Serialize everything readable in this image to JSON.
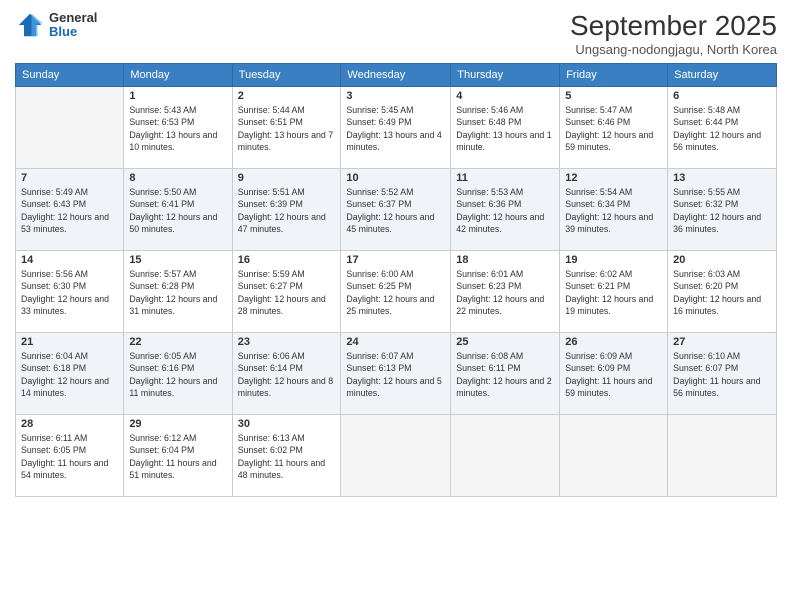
{
  "header": {
    "logo_general": "General",
    "logo_blue": "Blue",
    "month_title": "September 2025",
    "location": "Ungsang-nodongjagu, North Korea"
  },
  "days_of_week": [
    "Sunday",
    "Monday",
    "Tuesday",
    "Wednesday",
    "Thursday",
    "Friday",
    "Saturday"
  ],
  "weeks": [
    [
      {
        "day": "",
        "sunrise": "",
        "sunset": "",
        "daylight": ""
      },
      {
        "day": "1",
        "sunrise": "Sunrise: 5:43 AM",
        "sunset": "Sunset: 6:53 PM",
        "daylight": "Daylight: 13 hours and 10 minutes."
      },
      {
        "day": "2",
        "sunrise": "Sunrise: 5:44 AM",
        "sunset": "Sunset: 6:51 PM",
        "daylight": "Daylight: 13 hours and 7 minutes."
      },
      {
        "day": "3",
        "sunrise": "Sunrise: 5:45 AM",
        "sunset": "Sunset: 6:49 PM",
        "daylight": "Daylight: 13 hours and 4 minutes."
      },
      {
        "day": "4",
        "sunrise": "Sunrise: 5:46 AM",
        "sunset": "Sunset: 6:48 PM",
        "daylight": "Daylight: 13 hours and 1 minute."
      },
      {
        "day": "5",
        "sunrise": "Sunrise: 5:47 AM",
        "sunset": "Sunset: 6:46 PM",
        "daylight": "Daylight: 12 hours and 59 minutes."
      },
      {
        "day": "6",
        "sunrise": "Sunrise: 5:48 AM",
        "sunset": "Sunset: 6:44 PM",
        "daylight": "Daylight: 12 hours and 56 minutes."
      }
    ],
    [
      {
        "day": "7",
        "sunrise": "Sunrise: 5:49 AM",
        "sunset": "Sunset: 6:43 PM",
        "daylight": "Daylight: 12 hours and 53 minutes."
      },
      {
        "day": "8",
        "sunrise": "Sunrise: 5:50 AM",
        "sunset": "Sunset: 6:41 PM",
        "daylight": "Daylight: 12 hours and 50 minutes."
      },
      {
        "day": "9",
        "sunrise": "Sunrise: 5:51 AM",
        "sunset": "Sunset: 6:39 PM",
        "daylight": "Daylight: 12 hours and 47 minutes."
      },
      {
        "day": "10",
        "sunrise": "Sunrise: 5:52 AM",
        "sunset": "Sunset: 6:37 PM",
        "daylight": "Daylight: 12 hours and 45 minutes."
      },
      {
        "day": "11",
        "sunrise": "Sunrise: 5:53 AM",
        "sunset": "Sunset: 6:36 PM",
        "daylight": "Daylight: 12 hours and 42 minutes."
      },
      {
        "day": "12",
        "sunrise": "Sunrise: 5:54 AM",
        "sunset": "Sunset: 6:34 PM",
        "daylight": "Daylight: 12 hours and 39 minutes."
      },
      {
        "day": "13",
        "sunrise": "Sunrise: 5:55 AM",
        "sunset": "Sunset: 6:32 PM",
        "daylight": "Daylight: 12 hours and 36 minutes."
      }
    ],
    [
      {
        "day": "14",
        "sunrise": "Sunrise: 5:56 AM",
        "sunset": "Sunset: 6:30 PM",
        "daylight": "Daylight: 12 hours and 33 minutes."
      },
      {
        "day": "15",
        "sunrise": "Sunrise: 5:57 AM",
        "sunset": "Sunset: 6:28 PM",
        "daylight": "Daylight: 12 hours and 31 minutes."
      },
      {
        "day": "16",
        "sunrise": "Sunrise: 5:59 AM",
        "sunset": "Sunset: 6:27 PM",
        "daylight": "Daylight: 12 hours and 28 minutes."
      },
      {
        "day": "17",
        "sunrise": "Sunrise: 6:00 AM",
        "sunset": "Sunset: 6:25 PM",
        "daylight": "Daylight: 12 hours and 25 minutes."
      },
      {
        "day": "18",
        "sunrise": "Sunrise: 6:01 AM",
        "sunset": "Sunset: 6:23 PM",
        "daylight": "Daylight: 12 hours and 22 minutes."
      },
      {
        "day": "19",
        "sunrise": "Sunrise: 6:02 AM",
        "sunset": "Sunset: 6:21 PM",
        "daylight": "Daylight: 12 hours and 19 minutes."
      },
      {
        "day": "20",
        "sunrise": "Sunrise: 6:03 AM",
        "sunset": "Sunset: 6:20 PM",
        "daylight": "Daylight: 12 hours and 16 minutes."
      }
    ],
    [
      {
        "day": "21",
        "sunrise": "Sunrise: 6:04 AM",
        "sunset": "Sunset: 6:18 PM",
        "daylight": "Daylight: 12 hours and 14 minutes."
      },
      {
        "day": "22",
        "sunrise": "Sunrise: 6:05 AM",
        "sunset": "Sunset: 6:16 PM",
        "daylight": "Daylight: 12 hours and 11 minutes."
      },
      {
        "day": "23",
        "sunrise": "Sunrise: 6:06 AM",
        "sunset": "Sunset: 6:14 PM",
        "daylight": "Daylight: 12 hours and 8 minutes."
      },
      {
        "day": "24",
        "sunrise": "Sunrise: 6:07 AM",
        "sunset": "Sunset: 6:13 PM",
        "daylight": "Daylight: 12 hours and 5 minutes."
      },
      {
        "day": "25",
        "sunrise": "Sunrise: 6:08 AM",
        "sunset": "Sunset: 6:11 PM",
        "daylight": "Daylight: 12 hours and 2 minutes."
      },
      {
        "day": "26",
        "sunrise": "Sunrise: 6:09 AM",
        "sunset": "Sunset: 6:09 PM",
        "daylight": "Daylight: 11 hours and 59 minutes."
      },
      {
        "day": "27",
        "sunrise": "Sunrise: 6:10 AM",
        "sunset": "Sunset: 6:07 PM",
        "daylight": "Daylight: 11 hours and 56 minutes."
      }
    ],
    [
      {
        "day": "28",
        "sunrise": "Sunrise: 6:11 AM",
        "sunset": "Sunset: 6:05 PM",
        "daylight": "Daylight: 11 hours and 54 minutes."
      },
      {
        "day": "29",
        "sunrise": "Sunrise: 6:12 AM",
        "sunset": "Sunset: 6:04 PM",
        "daylight": "Daylight: 11 hours and 51 minutes."
      },
      {
        "day": "30",
        "sunrise": "Sunrise: 6:13 AM",
        "sunset": "Sunset: 6:02 PM",
        "daylight": "Daylight: 11 hours and 48 minutes."
      },
      {
        "day": "",
        "sunrise": "",
        "sunset": "",
        "daylight": ""
      },
      {
        "day": "",
        "sunrise": "",
        "sunset": "",
        "daylight": ""
      },
      {
        "day": "",
        "sunrise": "",
        "sunset": "",
        "daylight": ""
      },
      {
        "day": "",
        "sunrise": "",
        "sunset": "",
        "daylight": ""
      }
    ]
  ]
}
